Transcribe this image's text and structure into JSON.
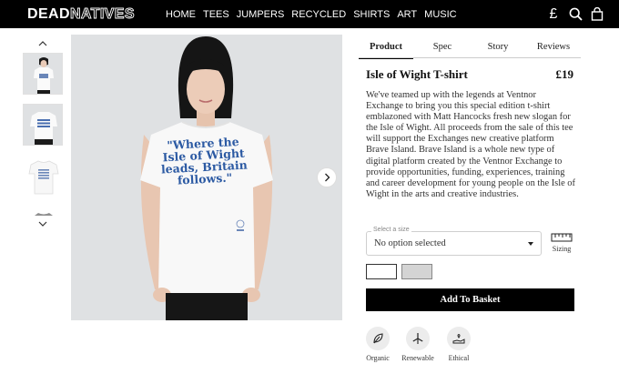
{
  "header": {
    "logo_bold": "DEAD",
    "logo_outline": "NATIVES",
    "nav": [
      "HOME",
      "TEES",
      "JUMPERS",
      "RECYCLED",
      "SHIRTS",
      "ART",
      "MUSIC"
    ],
    "currency_symbol": "£",
    "icons": [
      "currency-icon",
      "search-icon",
      "basket-icon"
    ]
  },
  "gallery": {
    "thumbnails": [
      "model-front",
      "model-tee-closeup",
      "tee-flat",
      "tee-grey-partial"
    ],
    "slogan": [
      "\"Where the",
      "Isle of Wight",
      "leads, Britain",
      "follows.\""
    ]
  },
  "tabs": [
    {
      "label": "Product",
      "active": true
    },
    {
      "label": "Spec",
      "active": false
    },
    {
      "label": "Story",
      "active": false
    },
    {
      "label": "Reviews",
      "active": false
    }
  ],
  "product": {
    "title": "Isle of Wight T-shirt",
    "price": "£19",
    "description": "We've teamed up with the legends at Ventnor Exchange to bring you this special edition t-shirt emblazoned with Matt Hancocks fresh new slogan for the Isle of Wight. All proceeds from the sale of this tee will support the Exchanges new creative platform Brave Island. Brave Island is a whole new type of digital platform created by the Ventnor Exchange to provide opportunities, funding, experiences, training and career development for young people on the Isle of Wight in the arts and creative industries."
  },
  "size": {
    "label": "Select a size",
    "value": "No option selected",
    "sizing_label": "Sizing"
  },
  "swatches": [
    {
      "color": "#ffffff",
      "selected": true
    },
    {
      "color": "#d4d4d4",
      "selected": false
    }
  ],
  "basket_label": "Add To Basket",
  "badges": [
    {
      "label": "Organic",
      "icon": "leaf-icon"
    },
    {
      "label": "Renewable",
      "icon": "wind-turbine-icon"
    },
    {
      "label": "Ethical",
      "icon": "hand-heart-icon"
    }
  ]
}
